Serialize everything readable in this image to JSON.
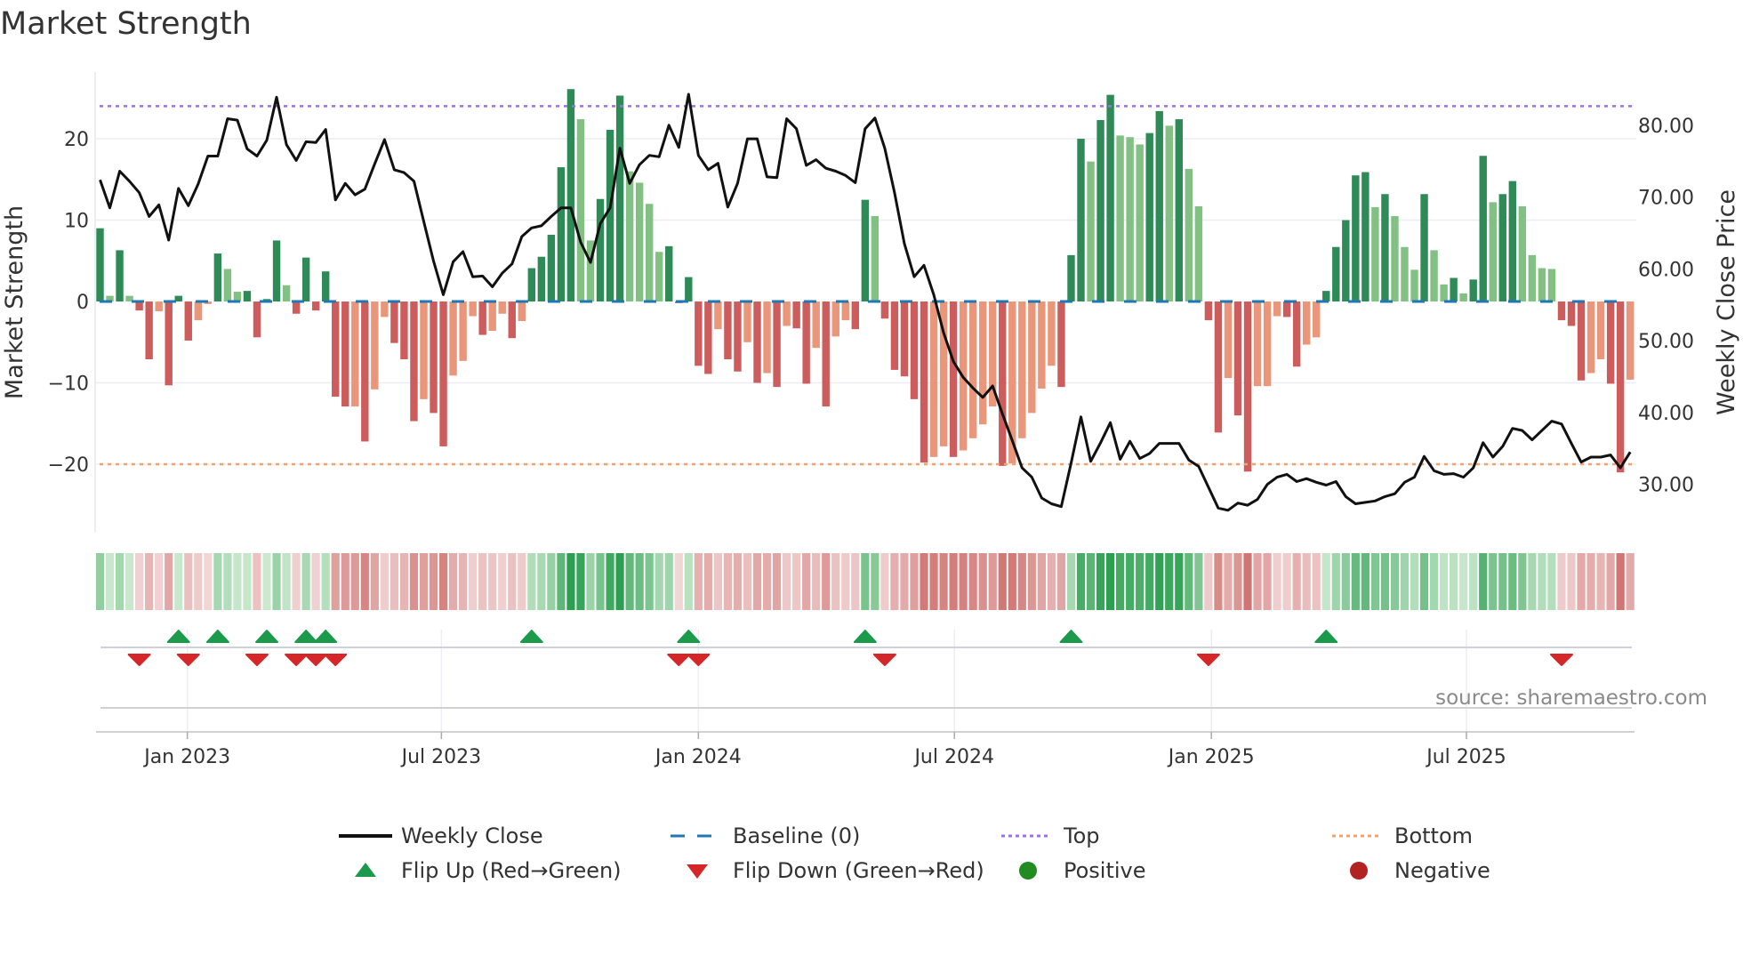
{
  "title": "Market Strength",
  "source": "source: sharemaestro.com",
  "colors": {
    "pos_strong": "#2e8b57",
    "pos_weak": "#82c084",
    "neg_strong": "#cd5c5c",
    "neg_weak": "#e9967a",
    "price": "#111111",
    "baseline": "#1f77b4",
    "top": "#a070e0",
    "bottom": "#f2a36c",
    "flip_up": "#1a9a4a",
    "flip_down": "#d62728",
    "positive": "#228b22",
    "negative": "#b22222"
  },
  "legend": [
    {
      "label": "Weekly Close",
      "symbol": "line"
    },
    {
      "label": "Baseline (0)",
      "symbol": "dash"
    },
    {
      "label": "Top",
      "symbol": "dot-purple"
    },
    {
      "label": "Bottom",
      "symbol": "dot-orange"
    },
    {
      "label": "Flip Up (Red→Green)",
      "symbol": "triangle-up"
    },
    {
      "label": "Flip Down (Green→Red)",
      "symbol": "triangle-down"
    },
    {
      "label": "Positive",
      "symbol": "circle-green"
    },
    {
      "label": "Negative",
      "symbol": "circle-red"
    }
  ],
  "chart_data": {
    "type": "bar",
    "title": "Market Strength",
    "xlabel": "",
    "ylabel": "Market Strength",
    "y2label": "Weekly Close Price",
    "ylim": [
      -28.3,
      28.2
    ],
    "y2lim": [
      23.4,
      87.4
    ],
    "yticks": [
      {
        "v": 20,
        "label": "20"
      },
      {
        "v": 10,
        "label": "10"
      },
      {
        "v": 0,
        "label": "0"
      },
      {
        "v": -10,
        "label": "−10"
      },
      {
        "v": -20,
        "label": "−20"
      }
    ],
    "y2ticks": [
      {
        "v": 80,
        "label": "80.00"
      },
      {
        "v": 70,
        "label": "70.00"
      },
      {
        "v": 60,
        "label": "60.00"
      },
      {
        "v": 50,
        "label": "50.00"
      },
      {
        "v": 40,
        "label": "40.00"
      },
      {
        "v": 30,
        "label": "30.00"
      }
    ],
    "xticks": [
      {
        "week": 8.9,
        "label": "Jan 2023"
      },
      {
        "week": 34.8,
        "label": "Jul 2023"
      },
      {
        "week": 61.0,
        "label": "Jan 2024"
      },
      {
        "week": 87.1,
        "label": "Jul 2024"
      },
      {
        "week": 113.3,
        "label": "Jan 2025"
      },
      {
        "week": 139.3,
        "label": "Jul 2025"
      }
    ],
    "top_level": 24,
    "bottom_level": -20,
    "baseline": 0,
    "strength": [
      9.0,
      0.7,
      6.3,
      0.7,
      -1.1,
      -7.1,
      -1.2,
      -10.3,
      0.7,
      -4.8,
      -2.3,
      -0.3,
      5.9,
      4.0,
      1.2,
      1.3,
      -4.4,
      0.3,
      7.5,
      2.0,
      -1.5,
      5.4,
      -1.1,
      3.7,
      -11.7,
      -12.9,
      -12.9,
      -17.2,
      -10.8,
      -1.9,
      -5.1,
      -7.1,
      -14.7,
      -12.0,
      -13.7,
      -17.8,
      -9.1,
      -7.3,
      -1.8,
      -4.1,
      -3.6,
      -1.5,
      -4.5,
      -2.4,
      4.1,
      5.5,
      8.2,
      16.5,
      26.1,
      22.4,
      7.5,
      12.6,
      21.1,
      25.3,
      16.0,
      14.6,
      12.0,
      6.1,
      6.8,
      -0.2,
      3.0,
      -7.9,
      -8.9,
      -3.4,
      -7.1,
      -8.6,
      -5.0,
      -10.0,
      -8.8,
      -10.5,
      -3.0,
      -3.3,
      -10.1,
      -5.7,
      -12.9,
      -4.3,
      -2.3,
      -3.4,
      12.5,
      10.5,
      -2.1,
      -8.4,
      -9.2,
      -12.0,
      -19.8,
      -19.1,
      -17.8,
      -19.1,
      -18.3,
      -16.8,
      -15.1,
      -12.9,
      -20.2,
      -19.9,
      -16.8,
      -13.7,
      -10.7,
      -7.9,
      -10.5,
      5.7,
      20.0,
      17.2,
      22.3,
      25.4,
      20.4,
      20.2,
      19.3,
      20.7,
      23.4,
      21.6,
      22.4,
      16.3,
      11.7,
      -2.3,
      -16.1,
      -9.4,
      -14.0,
      -20.9,
      -10.4,
      -10.4,
      -1.8,
      -1.9,
      -8.0,
      -5.3,
      -4.4,
      1.3,
      6.7,
      10.0,
      15.5,
      15.9,
      11.6,
      13.2,
      10.5,
      6.7,
      3.9,
      13.2,
      6.3,
      2.1,
      2.9,
      1.0,
      2.7,
      17.9,
      12.2,
      13.2,
      14.8,
      11.7,
      5.7,
      4.1,
      4.0,
      -2.3,
      -3.0,
      -9.7,
      -8.8,
      -7.1,
      -10.1,
      -21.0,
      -9.6
    ],
    "weekly_close": [
      72.4,
      68.5,
      73.6,
      72.2,
      70.6,
      67.3,
      68.9,
      64.0,
      71.2,
      68.8,
      71.8,
      75.7,
      75.7,
      80.9,
      80.7,
      76.7,
      75.7,
      77.9,
      83.9,
      77.3,
      75.1,
      77.7,
      77.6,
      79.4,
      69.6,
      71.9,
      70.3,
      71.1,
      74.6,
      78.0,
      73.8,
      73.4,
      72.2,
      66.6,
      61.1,
      56.4,
      61.0,
      62.4,
      58.9,
      59.0,
      57.5,
      59.4,
      60.7,
      64.5,
      65.7,
      66.0,
      67.3,
      68.5,
      68.5,
      63.7,
      60.9,
      66.3,
      68.5,
      76.8,
      71.9,
      74.5,
      75.8,
      75.6,
      80.0,
      76.9,
      84.3,
      75.8,
      73.8,
      74.7,
      68.6,
      71.9,
      78.1,
      78.1,
      72.8,
      72.7,
      80.9,
      79.5,
      74.4,
      75.2,
      74.0,
      73.6,
      73.0,
      72.0,
      79.5,
      81.0,
      76.8,
      70.6,
      63.5,
      58.9,
      60.5,
      56.4,
      51.1,
      47.1,
      44.9,
      43.4,
      42.1,
      43.7,
      39.8,
      36.1,
      32.3,
      31.0,
      28.1,
      27.3,
      26.9,
      33.0,
      39.4,
      33.2,
      35.8,
      38.6,
      33.5,
      36.0,
      33.6,
      34.3,
      35.7,
      35.7,
      35.7,
      33.4,
      32.5,
      29.6,
      26.7,
      26.4,
      27.4,
      27.1,
      27.9,
      30.0,
      31.0,
      31.4,
      30.4,
      30.8,
      30.3,
      29.9,
      30.4,
      28.3,
      27.3,
      27.5,
      27.7,
      28.3,
      28.7,
      30.3,
      31.0,
      33.9,
      31.9,
      31.4,
      31.5,
      31.0,
      32.3,
      35.8,
      33.8,
      35.3,
      37.8,
      37.5,
      36.2,
      37.5,
      38.8,
      38.4,
      35.7,
      33.1,
      33.8,
      33.8,
      34.1,
      32.3,
      34.5
    ],
    "flip_up_weeks": [
      8,
      12,
      17,
      21,
      23,
      44,
      60,
      78,
      99,
      125
    ],
    "flip_down_weeks": [
      4,
      9,
      16,
      20,
      22,
      24,
      59,
      61,
      80,
      113,
      149
    ]
  }
}
